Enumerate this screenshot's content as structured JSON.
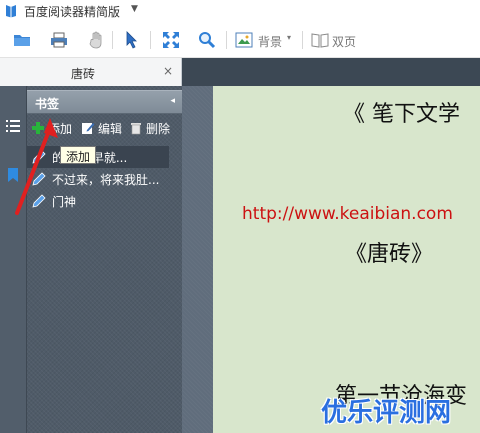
{
  "app": {
    "title": "百度阅读器精简版",
    "menu_arrow": "▼"
  },
  "toolbar": {
    "items": [
      {
        "name": "open-icon"
      },
      {
        "name": "print-icon"
      },
      {
        "name": "hand-icon"
      },
      {
        "name": "select-cursor-icon"
      },
      {
        "name": "fullscreen-icon"
      },
      {
        "name": "zoom-icon"
      }
    ],
    "background_label": "背景",
    "double_page_label": "双页",
    "dropdown_arrow": "▾"
  },
  "tab": {
    "title": "唐砖",
    "close": "×"
  },
  "bookmarks": {
    "header": "书签",
    "collapse": "◂",
    "add_label": "添加",
    "edit_label": "编辑",
    "delete_label": "删除",
    "tooltip": "添加",
    "items": [
      {
        "label": "的 这是早就..."
      },
      {
        "label": "不过来，将来我肚..."
      },
      {
        "label": "门神"
      }
    ]
  },
  "page": {
    "line1": "《 笔下文学",
    "url": "http://www.keaibian.com",
    "line3": "《唐砖》",
    "line4": "第一节沧海变"
  },
  "watermark": "优乐评测网",
  "colors": {
    "accent_blue": "#2a6fe0",
    "url_red": "#cc1111",
    "page_bg": "#d8e6cc",
    "panel_bg": "#4f5b68",
    "arrow_red": "#e02020"
  }
}
